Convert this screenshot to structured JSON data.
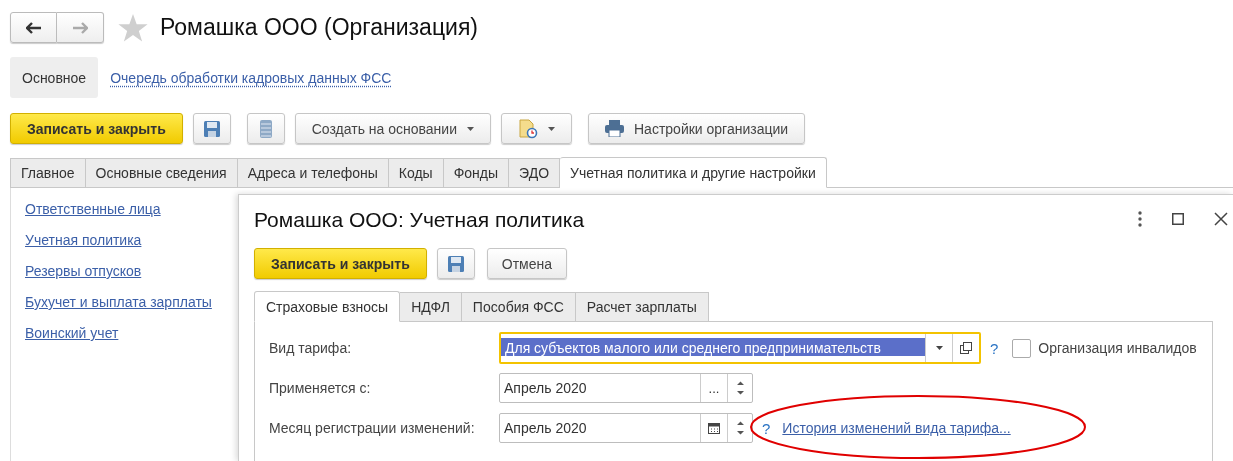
{
  "window": {
    "title": "Ромашка ООО (Организация)",
    "favorite": false
  },
  "sections": [
    {
      "label": "Основное",
      "selected": true
    },
    {
      "label": "Очередь обработки кадровых данных ФСС",
      "selected": false
    }
  ],
  "toolbar": {
    "primary": "Записать и закрыть",
    "create_based": "Создать на основании",
    "settings": "Настройки организации"
  },
  "tabs": [
    {
      "label": "Главное",
      "selected": false
    },
    {
      "label": "Основные сведения",
      "selected": false
    },
    {
      "label": "Адреса и телефоны",
      "selected": false
    },
    {
      "label": "Коды",
      "selected": false
    },
    {
      "label": "Фонды",
      "selected": false
    },
    {
      "label": "ЭДО",
      "selected": false
    },
    {
      "label": "Учетная политика и другие настройки",
      "selected": true
    }
  ],
  "sidebar": {
    "items": [
      "Ответственные лица",
      "Учетная политика",
      "Резервы отпусков",
      "Бухучет и выплата зарплаты",
      "Воинский учет"
    ]
  },
  "dialog": {
    "title": "Ромашка ООО: Учетная политика",
    "buttons": {
      "primary": "Записать и закрыть",
      "cancel": "Отмена"
    },
    "tabs": [
      {
        "label": "Страховые взносы",
        "selected": true
      },
      {
        "label": "НДФЛ",
        "selected": false
      },
      {
        "label": "Пособия ФСС",
        "selected": false
      },
      {
        "label": "Расчет зарплаты",
        "selected": false
      }
    ],
    "fields": [
      {
        "kind": "combo",
        "label": "Вид тарифа:",
        "value": "Для субъектов малого или среднего предпринимательств",
        "focused": true,
        "help": "?",
        "checkbox": {
          "label": "Организация инвалидов",
          "checked": false
        }
      },
      {
        "kind": "period",
        "label": "Применяется с:",
        "value": "Апрель 2020",
        "focused": false,
        "button": "..."
      },
      {
        "kind": "date",
        "label": "Месяц регистрации изменений:",
        "value": "Апрель 2020",
        "focused": false,
        "help": "?",
        "link": "История изменений вида тарифа..."
      }
    ]
  }
}
